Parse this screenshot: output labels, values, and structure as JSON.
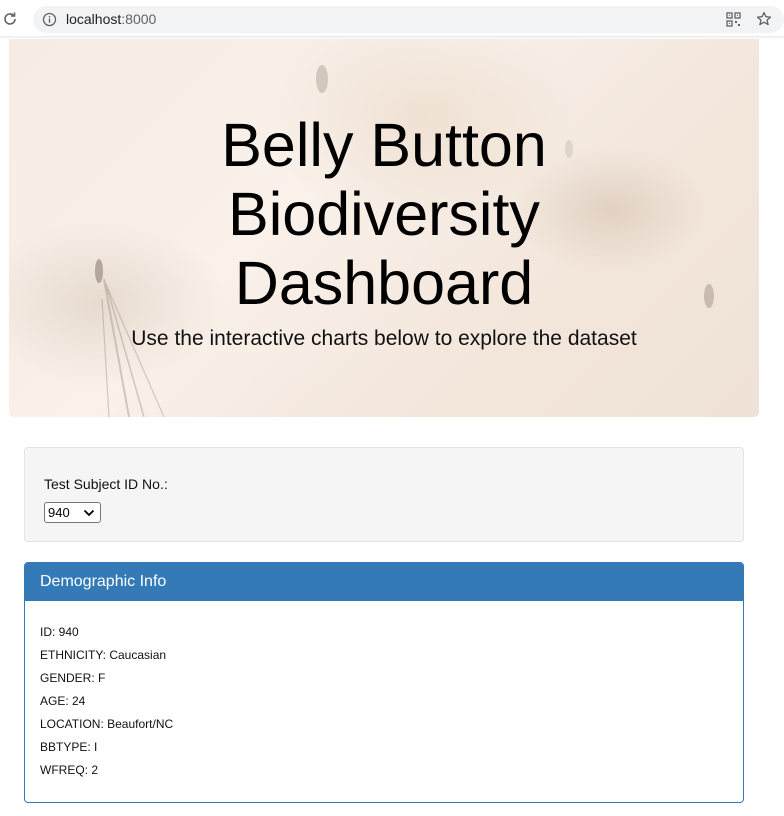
{
  "browser": {
    "url_host": "localhost",
    "url_port": ":8000"
  },
  "icons": {
    "reload": "reload-icon",
    "info": "info-icon",
    "qr": "qr-code-icon",
    "star": "star-icon",
    "chevron": "chevron-down-icon"
  },
  "jumbotron": {
    "title_lines": [
      "Belly Button",
      "Biodiversity",
      "Dashboard"
    ],
    "subtitle": "Use the interactive charts below to explore the dataset"
  },
  "selector": {
    "label": "Test Subject ID No.:",
    "selected_value": "940"
  },
  "demographics": {
    "title": "Demographic Info",
    "lines": [
      "ID: 940",
      "ETHNICITY: Caucasian",
      "GENDER: F",
      "AGE: 24",
      "LOCATION: Beaufort/NC",
      "BBTYPE: I",
      "WFREQ: 2"
    ]
  },
  "colors": {
    "panel_primary": "#337ab7",
    "well_bg": "#f5f5f5",
    "omnibox_bg": "#f1f3f4"
  }
}
